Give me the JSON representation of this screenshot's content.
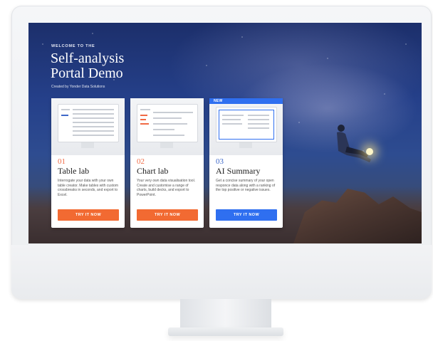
{
  "header": {
    "welcome": "WELCOME TO THE",
    "title_line1": "Self-analysis",
    "title_line2": "Portal Demo",
    "subtitle": "Created by Yonder Data Solutions"
  },
  "cards": [
    {
      "number": "01",
      "title": "Table lab",
      "description": "Interrogate your data with your own table creator. Make tables with custom crossbreaks in seconds, and export to Excel.",
      "button": "TRY IT NOW"
    },
    {
      "number": "02",
      "title": "Chart lab",
      "description": "Your very own data visualisation tool. Create and customise a range of charts, build decks, and export to PowerPoint.",
      "button": "TRY IT NOW"
    },
    {
      "number": "03",
      "title": "AI Summary",
      "badge": "NEW",
      "description": "Get a concise summary of your open responce data along with a ranking of the top positive or negative issues.",
      "button": "TRY IT NOW"
    }
  ],
  "colors": {
    "accent_orange": "#f26a32",
    "accent_blue": "#2f6ff0"
  }
}
